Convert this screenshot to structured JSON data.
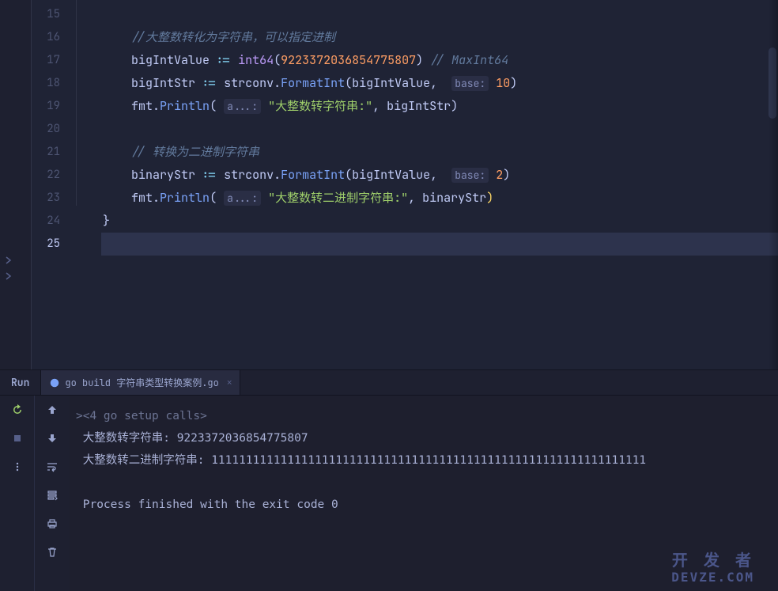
{
  "run_label": "Run",
  "run_tab": {
    "title": "go build 字符串类型转换案例.go"
  },
  "gutter": {
    "start": 15,
    "end": 25,
    "current": 25
  },
  "code": {
    "comment16": "//大整数转化为字符串，可以指定进制",
    "line17": {
      "ident": "bigIntValue",
      "op": ":=",
      "fn": "int64",
      "val": "9223372036854775807",
      "trail_comment": "// MaxInt64"
    },
    "line18": {
      "ident": "bigIntStr",
      "op": ":=",
      "pkg": "strconv",
      "fn": "FormatInt",
      "arg1": "bigIntValue",
      "hint": "base:",
      "base": "10"
    },
    "line19": {
      "pkg": "fmt",
      "fn": "Println",
      "hint": "a...:",
      "str": "\"大整数转字符串:\"",
      "arg2": "bigIntStr"
    },
    "comment21": "// 转换为二进制字符串",
    "line22": {
      "ident": "binaryStr",
      "op": ":=",
      "pkg": "strconv",
      "fn": "FormatInt",
      "arg1": "bigIntValue",
      "hint": "base:",
      "base": "2"
    },
    "line23": {
      "pkg": "fmt",
      "fn": "Println",
      "hint": "a...:",
      "str": "\"大整数转二进制字符串:\"",
      "arg2": "binaryStr"
    },
    "line24": "}"
  },
  "console": {
    "fold": "<4 go setup calls>",
    "out1": "大整数转字符串: 9223372036854775807",
    "out2": "大整数转二进制字符串: 111111111111111111111111111111111111111111111111111111111111111",
    "exit": "Process finished with the exit code 0"
  },
  "watermark": {
    "l1": "开 发 者",
    "l2": "DEVZE.COM"
  }
}
